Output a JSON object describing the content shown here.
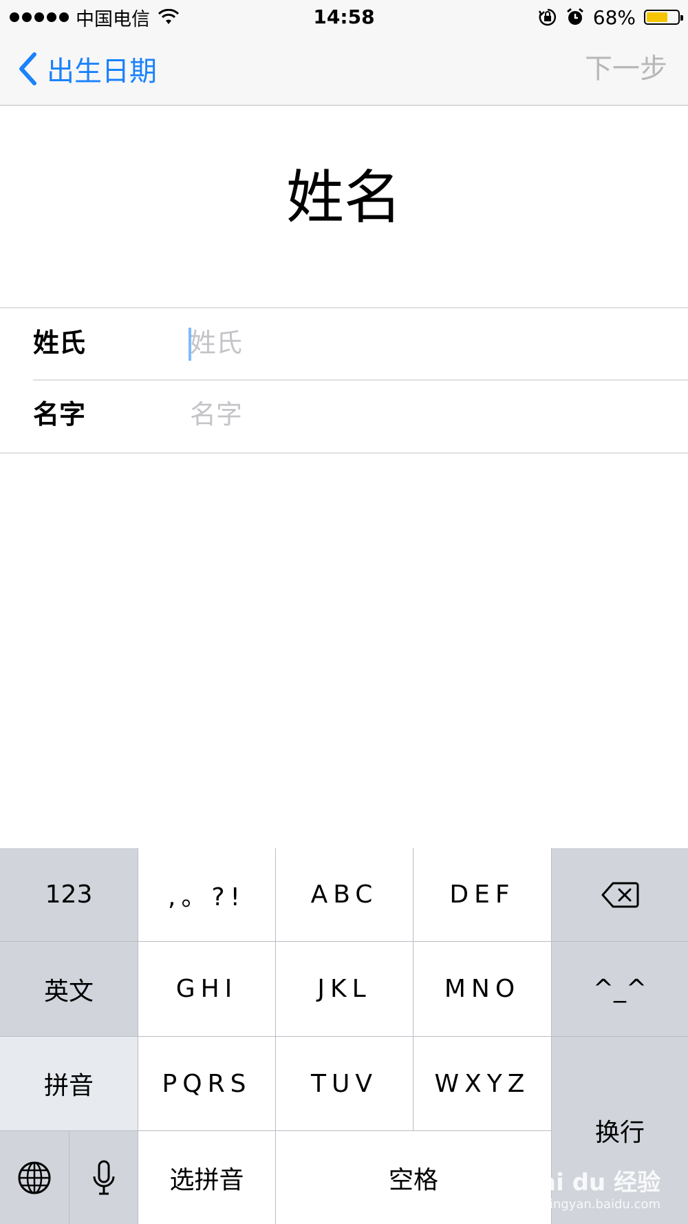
{
  "status_bar": {
    "carrier": "中国电信",
    "time": "14:58",
    "battery_percent": "68%",
    "battery_level": 0.68,
    "icons": [
      "signal-dots-icon",
      "wifi-icon",
      "orientation-lock-icon",
      "alarm-icon",
      "battery-icon"
    ]
  },
  "nav": {
    "back_label": "出生日期",
    "next_label": "下一步"
  },
  "page": {
    "title": "姓名"
  },
  "form": {
    "last_name_label": "姓氏",
    "last_name_placeholder": "姓氏",
    "first_name_label": "名字",
    "first_name_placeholder": "名字"
  },
  "keyboard": {
    "row1": [
      "123",
      ",。?!",
      "ABC",
      "DEF"
    ],
    "row2": [
      "英文",
      "GHI",
      "JKL",
      "MNO",
      "^_^"
    ],
    "row3": [
      "拼音",
      "PQRS",
      "TUV",
      "WXYZ"
    ],
    "row4_select": "选拼音",
    "row4_space": "空格",
    "return": "换行"
  },
  "watermark": {
    "brand": "Bai du 经验",
    "url": "jingyan.baidu.com"
  },
  "colors": {
    "accent": "#1a82fb",
    "disabled": "#b7b7b7",
    "placeholder": "#c4c4c8",
    "key_light": "#ffffff",
    "key_dark": "#d1d4da",
    "battery": "#f5c400"
  }
}
